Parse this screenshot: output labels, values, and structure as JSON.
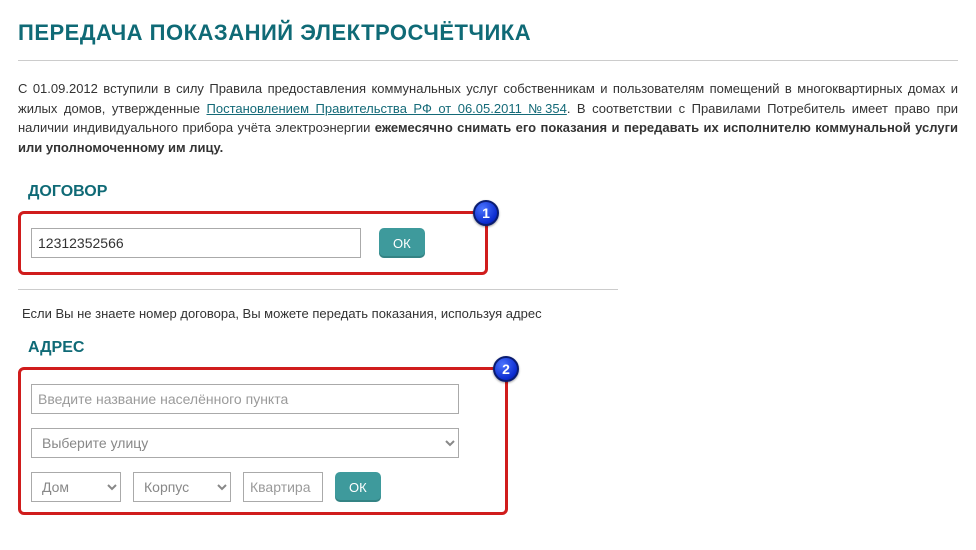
{
  "page": {
    "title": "ПЕРЕДАЧА ПОКАЗАНИЙ ЭЛЕКТРОСЧЁТЧИКА"
  },
  "intro": {
    "part1": "С 01.09.2012 вступили в силу Правила предоставления коммунальных услуг собственникам и пользователям помещений в многоквартирных домах и жилых домов, утвержденные ",
    "link": "Постановлением Правительства РФ от 06.05.2011 №354",
    "part2": ". В соответствии с Правилами Потребитель имеет право при наличии индивидуального прибора учёта электроэнергии ",
    "bold": "ежемесячно снимать его показания и передавать их исполнителю коммунальной услуги или уполномоченному им лицу."
  },
  "contract": {
    "section_label": "ДОГОВОР",
    "badge": "1",
    "input_value": "12312352566",
    "ok_label": "ОК"
  },
  "note_text": "Если Вы не знаете номер договора, Вы можете передать показания, используя адрес",
  "address": {
    "section_label": "АДРЕС",
    "badge": "2",
    "city_placeholder": "Введите название населённого пункта",
    "street_placeholder": "Выберите улицу",
    "house_placeholder": "Дом",
    "korpus_placeholder": "Корпус",
    "apt_placeholder": "Квартира",
    "ok_label": "ОК"
  }
}
